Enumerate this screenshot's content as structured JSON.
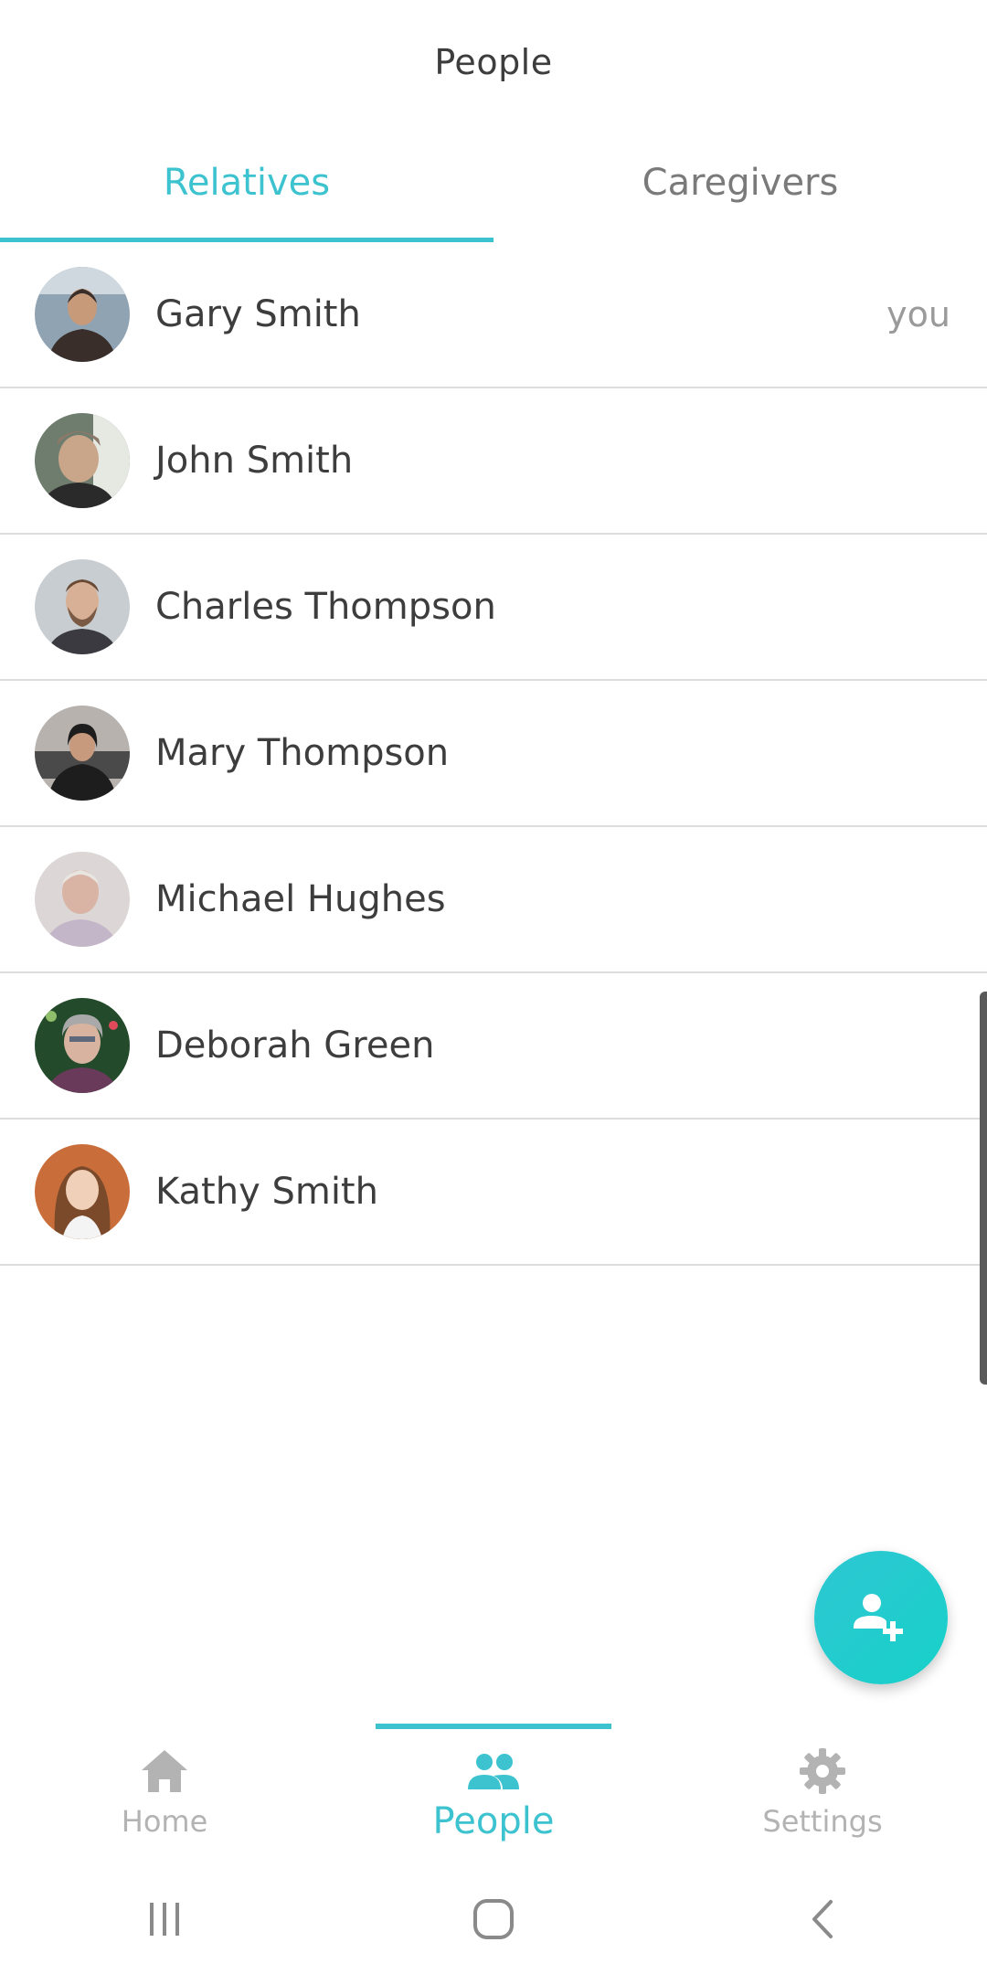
{
  "header": {
    "title": "People"
  },
  "tabs": [
    {
      "label": "Relatives",
      "active": true
    },
    {
      "label": "Caregivers",
      "active": false
    }
  ],
  "people": [
    {
      "name": "Gary Smith",
      "tag": "you",
      "avatar_colors": [
        "#8fa3b3",
        "#3a2e2a",
        "#c79a7a"
      ]
    },
    {
      "name": "John Smith",
      "tag": "",
      "avatar_colors": [
        "#6e7d6e",
        "#c9a68a",
        "#2a2a2a"
      ]
    },
    {
      "name": "Charles Thompson",
      "tag": "",
      "avatar_colors": [
        "#c8cdd2",
        "#7a5a44",
        "#d7b095"
      ]
    },
    {
      "name": "Mary Thompson",
      "tag": "",
      "avatar_colors": [
        "#b7b2ad",
        "#1d1d1d",
        "#c89a7d"
      ]
    },
    {
      "name": "Michael Hughes",
      "tag": "",
      "avatar_colors": [
        "#dcd6d6",
        "#d9b4a4",
        "#c3b6c8"
      ]
    },
    {
      "name": "Deborah Green",
      "tag": "",
      "avatar_colors": [
        "#234a2a",
        "#d8b3a0",
        "#a9a9a9"
      ]
    },
    {
      "name": "Kathy Smith",
      "tag": "",
      "avatar_colors": [
        "#c96d3a",
        "#f0d0b8",
        "#7a4a2a"
      ]
    }
  ],
  "fab": {
    "icon": "add-person-icon"
  },
  "bottom_nav": [
    {
      "label": "Home",
      "icon": "home-icon",
      "active": false
    },
    {
      "label": "People",
      "icon": "people-icon",
      "active": true
    },
    {
      "label": "Settings",
      "icon": "gear-icon",
      "active": false
    }
  ],
  "system_nav": [
    {
      "icon": "recent-apps-icon"
    },
    {
      "icon": "home-circle-icon"
    },
    {
      "icon": "back-icon"
    }
  ],
  "colors": {
    "accent": "#3cc3cf",
    "text": "#3d3d3d",
    "muted": "#9a9a9a",
    "divider": "#dcdcdc"
  }
}
